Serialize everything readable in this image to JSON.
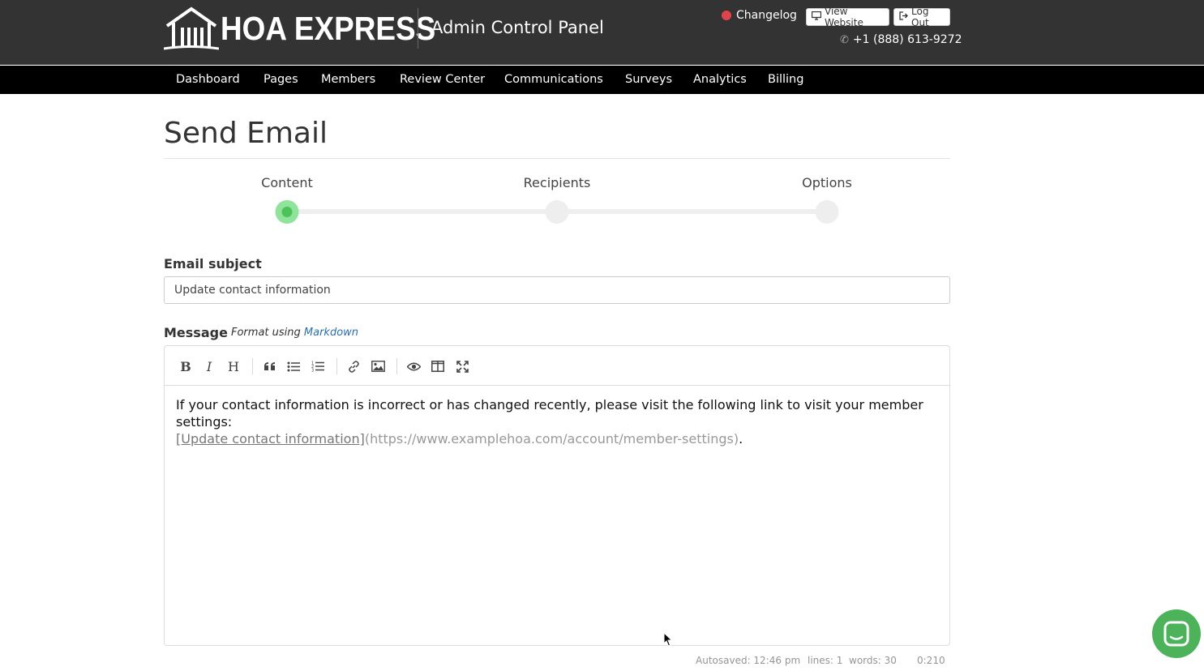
{
  "header": {
    "logo_text": "HOA EXPRESS",
    "panel_title": "Admin Control Panel",
    "changelog_label": "Changelog",
    "view_website_label": "View Website",
    "logout_label": "Log Out",
    "phone": "+1 (888) 613-9272"
  },
  "nav": {
    "items": [
      "Dashboard",
      "Pages",
      "Members",
      "Review Center",
      "Communications",
      "Surveys",
      "Analytics",
      "Billing"
    ]
  },
  "page": {
    "title": "Send Email"
  },
  "stepper": {
    "steps": [
      "Content",
      "Recipients",
      "Options"
    ],
    "active_step": "Content"
  },
  "form": {
    "subject_label": "Email subject",
    "subject_value": "Update contact information",
    "message_label": "Message",
    "format_prefix": "Format using",
    "format_link": "Markdown"
  },
  "editor": {
    "toolbar_icons": [
      "bold-icon",
      "italic-icon",
      "heading-icon",
      "quote-icon",
      "unordered-list-icon",
      "ordered-list-icon",
      "link-icon",
      "image-icon",
      "preview-icon",
      "side-by-side-icon",
      "fullscreen-icon"
    ],
    "line_text": "If your contact information is incorrect or has changed recently, please visit the following link to visit your member settings:",
    "link_text": "[Update contact information]",
    "link_url": "(https://www.examplehoa.com/account/member-settings)",
    "trailing": "."
  },
  "status": {
    "autosaved": "Autosaved: 12:46 pm",
    "lines": "lines: 1",
    "words": "words: 30",
    "cursor": "0:210"
  },
  "colors": {
    "header_bg": "#333333",
    "nav_bg": "#000000",
    "step_active": "#4cc35a",
    "changelog_dot": "#e0434b",
    "chat_bubble": "#4cb35a",
    "link": "#2a6fb0"
  }
}
